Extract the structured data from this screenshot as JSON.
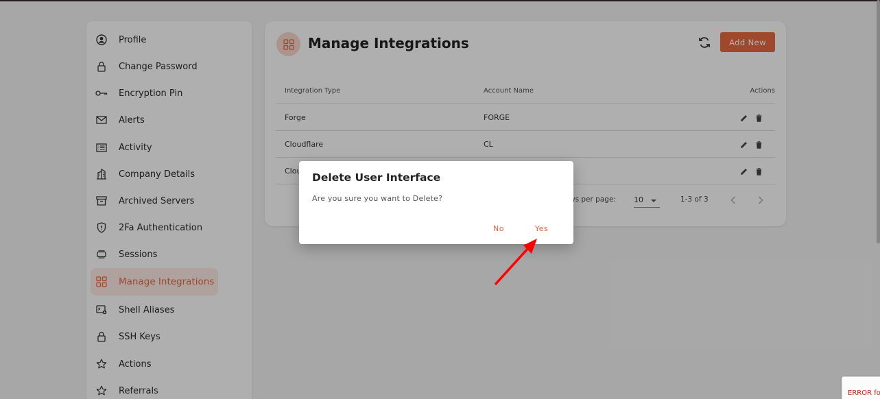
{
  "sidebar": {
    "items": [
      {
        "label": "Profile",
        "icon": "user-circle-icon"
      },
      {
        "label": "Change Password",
        "icon": "lock-icon"
      },
      {
        "label": "Encryption Pin",
        "icon": "key-icon"
      },
      {
        "label": "Alerts",
        "icon": "mail-icon"
      },
      {
        "label": "Activity",
        "icon": "list-icon"
      },
      {
        "label": "Company Details",
        "icon": "building-icon"
      },
      {
        "label": "Archived Servers",
        "icon": "archive-icon"
      },
      {
        "label": "2Fa Authentication",
        "icon": "shield-icon"
      },
      {
        "label": "Sessions",
        "icon": "sessions-icon"
      },
      {
        "label": "Manage Integrations",
        "icon": "grid-icon",
        "active": true
      },
      {
        "label": "Shell Aliases",
        "icon": "terminal-icon"
      },
      {
        "label": "SSH Keys",
        "icon": "lock-icon"
      },
      {
        "label": "Actions",
        "icon": "star-icon"
      },
      {
        "label": "Referrals",
        "icon": "star-icon"
      }
    ]
  },
  "main": {
    "title": "Manage Integrations",
    "add_button": "Add New",
    "table": {
      "headers": [
        "Integration Type",
        "Account Name",
        "Actions"
      ],
      "rows": [
        {
          "type": "Forge",
          "account": "FORGE"
        },
        {
          "type": "Cloudflare",
          "account": "CL"
        },
        {
          "type": "Clou",
          "account": ""
        }
      ]
    },
    "pagination": {
      "rows_per_page_label": "ws per page:",
      "rows_per_page_value": "10",
      "range": "1-3 of 3"
    }
  },
  "dialog": {
    "title": "Delete User Interface",
    "message": "Are you sure you want to Delete?",
    "no_label": "No",
    "yes_label": "Yes"
  },
  "error_badge": "ERROR fo",
  "colors": {
    "accent": "#e2673f",
    "accent_light": "#fbe7e1",
    "arrow": "#ff0000"
  }
}
